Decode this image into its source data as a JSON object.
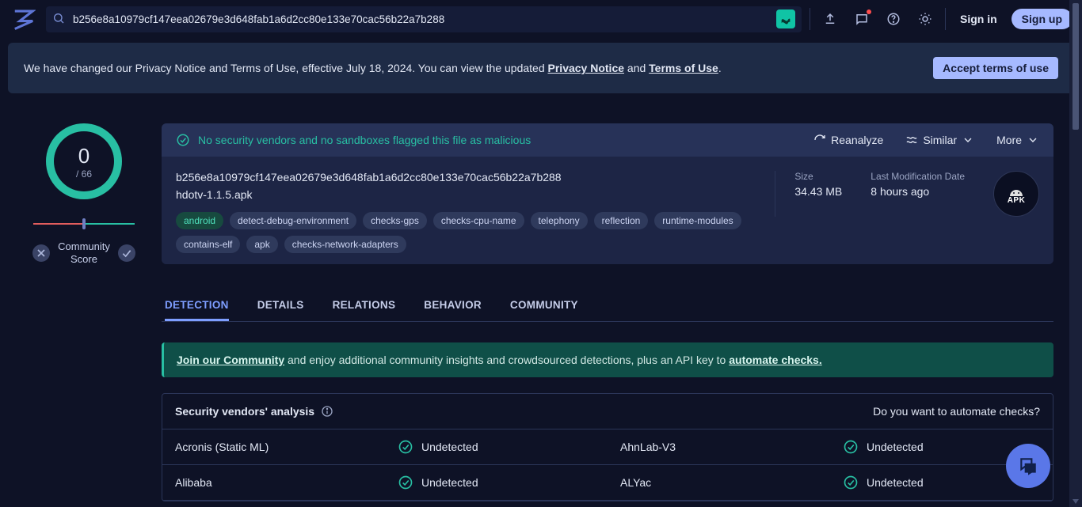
{
  "search": {
    "value": "b256e8a10979cf147eea02679e3d648fab1a6d2cc80e133e70cac56b22a7b288"
  },
  "auth": {
    "signin": "Sign in",
    "signup": "Sign up"
  },
  "notice": {
    "prefix": "We have changed our Privacy Notice and Terms of Use, effective July 18, 2024. You can view the updated ",
    "privacy": "Privacy Notice",
    "and": " and ",
    "terms": "Terms of Use",
    "suffix": ".",
    "accept": "Accept terms of use"
  },
  "score": {
    "num": "0",
    "den": "/ 66",
    "community_label_top": "Community",
    "community_label_bottom": "Score"
  },
  "panel": {
    "status": "No security vendors and no sandboxes flagged this file as malicious",
    "reanalyze": "Reanalyze",
    "similar": "Similar",
    "more": "More",
    "hash": "b256e8a10979cf147eea02679e3d648fab1a6d2cc80e133e70cac56b22a7b288",
    "filename": "hdotv-1.1.5.apk",
    "size_label": "Size",
    "size_value": "34.43 MB",
    "mod_label": "Last Modification Date",
    "mod_value": "8 hours ago",
    "apk_text": "APK"
  },
  "tags": [
    "android",
    "detect-debug-environment",
    "checks-gps",
    "checks-cpu-name",
    "telephony",
    "reflection",
    "runtime-modules",
    "contains-elf",
    "apk",
    "checks-network-adapters"
  ],
  "tabs": {
    "detection": "DETECTION",
    "details": "DETAILS",
    "relations": "RELATIONS",
    "behavior": "BEHAVIOR",
    "community": "COMMUNITY"
  },
  "promo": {
    "join": "Join our Community",
    "mid": " and enjoy additional community insights and crowdsourced detections, plus an API key to ",
    "automate": "automate checks."
  },
  "vendors": {
    "title": "Security vendors' analysis",
    "automate_q": "Do you want to automate checks?",
    "rows": [
      {
        "n1": "Acronis (Static ML)",
        "s1": "Undetected",
        "n2": "AhnLab-V3",
        "s2": "Undetected"
      },
      {
        "n1": "Alibaba",
        "s1": "Undetected",
        "n2": "ALYac",
        "s2": "Undetected"
      }
    ]
  }
}
